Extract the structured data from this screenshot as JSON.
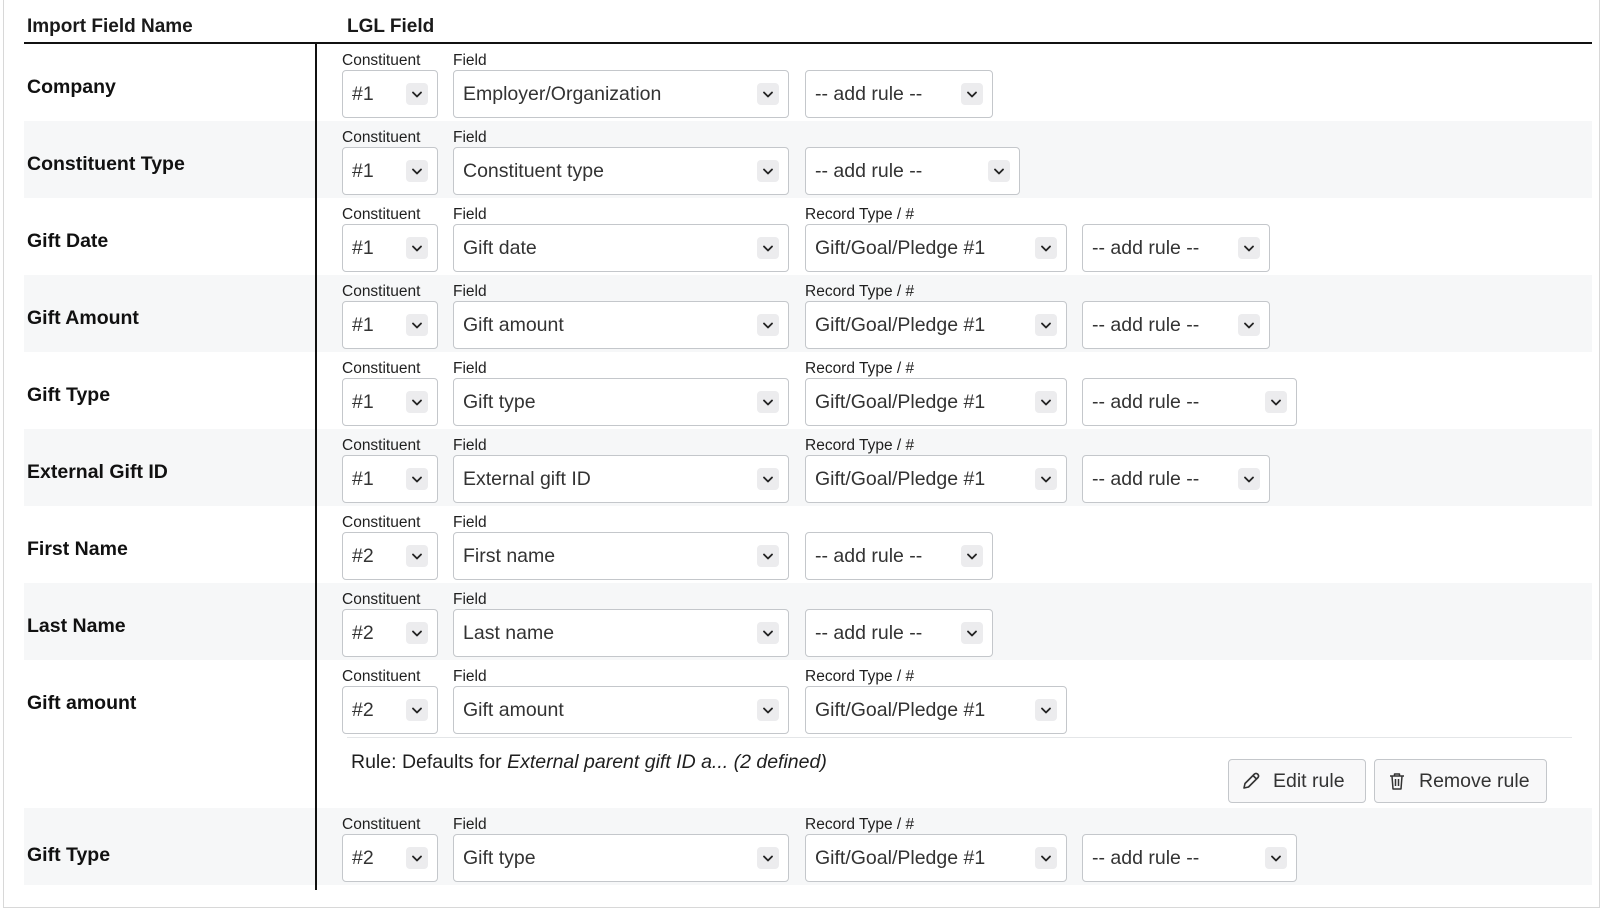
{
  "headers": {
    "import_field_name": "Import Field Name",
    "lgl_field": "LGL Field"
  },
  "labels": {
    "constituent": "Constituent",
    "field": "Field",
    "record_type": "Record Type / #"
  },
  "rows": [
    {
      "name": "Company",
      "constituent": "#1",
      "field": "Employer/Organization",
      "record": null,
      "rule": "-- add rule --"
    },
    {
      "name": "Constituent Type",
      "constituent": "#1",
      "field": "Constituent type",
      "record": null,
      "rule": "-- add rule --"
    },
    {
      "name": "Gift Date",
      "constituent": "#1",
      "field": "Gift date",
      "record": "Gift/Goal/Pledge #1",
      "rule": "-- add rule --"
    },
    {
      "name": "Gift Amount",
      "constituent": "#1",
      "field": "Gift amount",
      "record": "Gift/Goal/Pledge #1",
      "rule": "-- add rule --"
    },
    {
      "name": "Gift Type",
      "constituent": "#1",
      "field": "Gift type",
      "record": "Gift/Goal/Pledge #1",
      "rule": "-- add rule --"
    },
    {
      "name": "External Gift ID",
      "constituent": "#1",
      "field": "External gift ID",
      "record": "Gift/Goal/Pledge #1",
      "rule": "-- add rule --"
    },
    {
      "name": "First Name",
      "constituent": "#2",
      "field": "First name",
      "record": null,
      "rule": "-- add rule --"
    },
    {
      "name": "Last Name",
      "constituent": "#2",
      "field": "Last name",
      "record": null,
      "rule": "-- add rule --"
    },
    {
      "name": "Gift amount",
      "constituent": "#2",
      "field": "Gift amount",
      "record": "Gift/Goal/Pledge #1",
      "rule": null
    },
    {
      "name": "Gift Type",
      "constituent": "#2",
      "field": "Gift type",
      "record": "Gift/Goal/Pledge #1",
      "rule": "-- add rule --"
    }
  ],
  "rule_detail": {
    "prefix": "Rule: Defaults for",
    "name": "External parent gift ID a...",
    "suffix": "(2 defined)",
    "edit_label": "Edit rule",
    "remove_label": "Remove rule",
    "edit_icon": "pencil-icon",
    "remove_icon": "trash-icon"
  },
  "colors": {
    "shaded_row": "#f6f7f8",
    "border": "#c4c7cb",
    "divider": "#111111"
  }
}
